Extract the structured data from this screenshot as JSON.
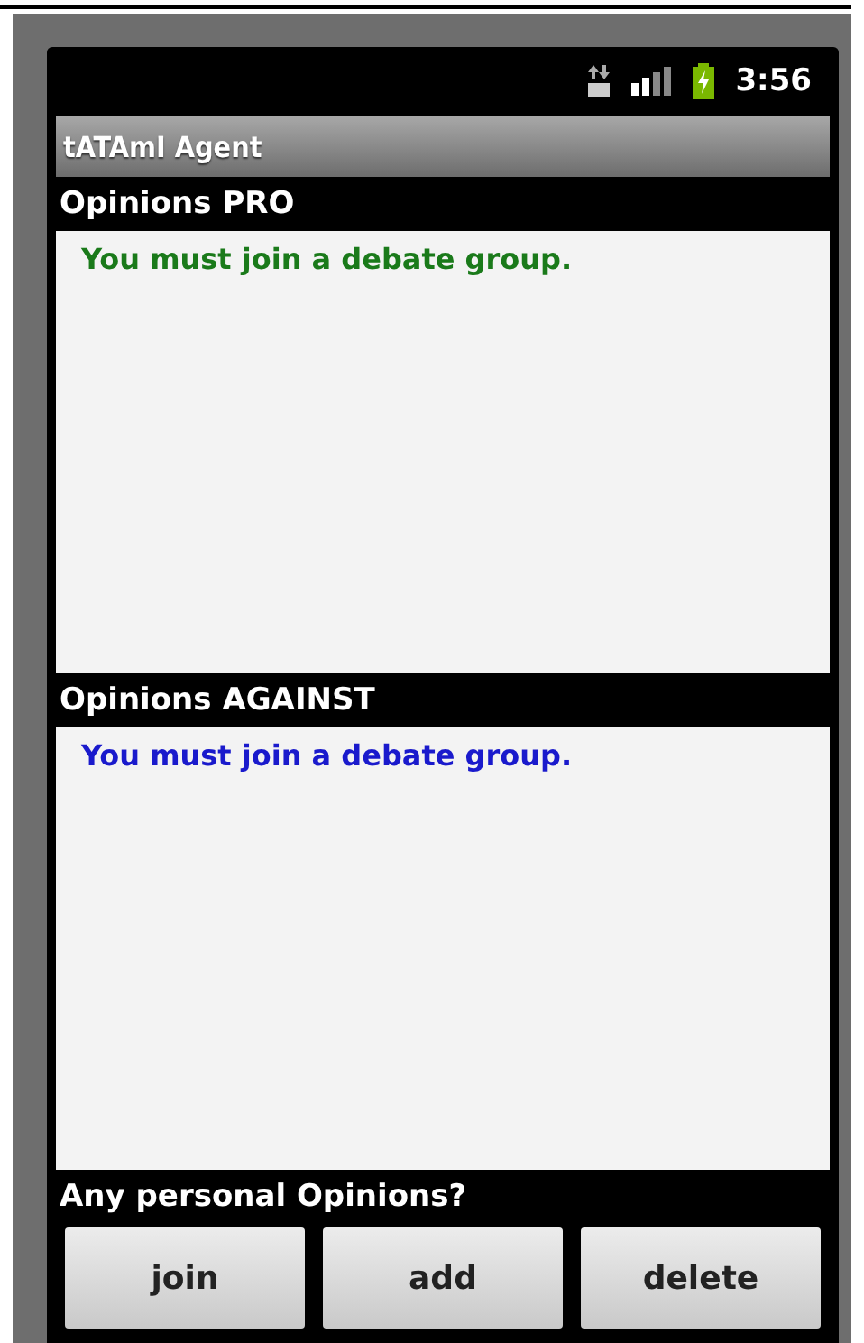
{
  "status_bar": {
    "time": "3:56"
  },
  "app_title": "tATAmI Agent",
  "panels": [
    {
      "heading": "Opinions PRO",
      "message": "You must join a debate group.",
      "color": "#1a7a1a"
    },
    {
      "heading": "Opinions AGAINST",
      "message": "You must join a debate group.",
      "color": "#1a1acc"
    }
  ],
  "prompt": "Any personal Opinions?",
  "buttons": [
    "join",
    "add",
    "delete"
  ]
}
